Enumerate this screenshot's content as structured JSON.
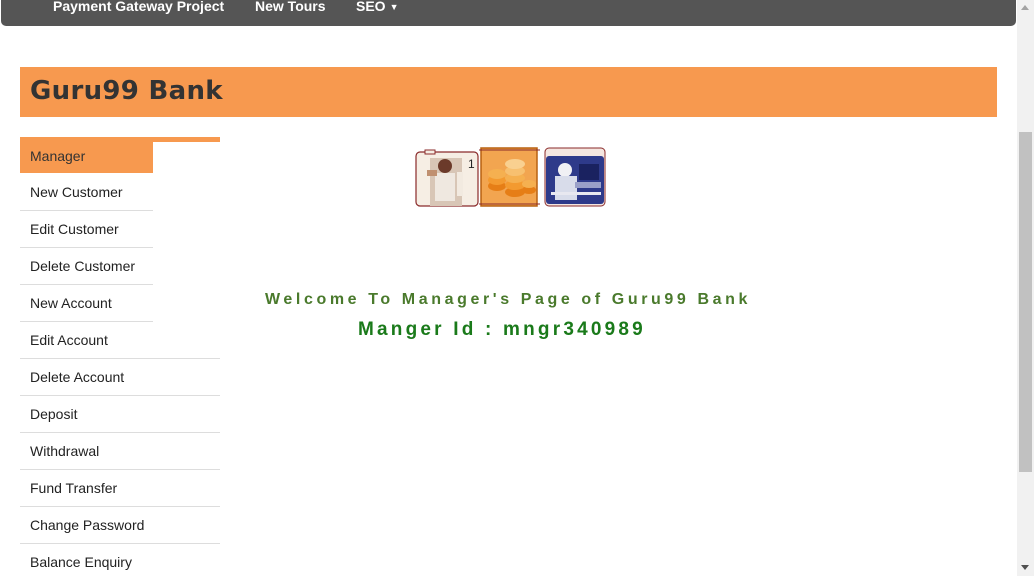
{
  "navbar": {
    "items": [
      {
        "label": "Payment Gateway Project"
      },
      {
        "label": "New Tours"
      },
      {
        "label": "SEO",
        "has_dropdown": true
      }
    ]
  },
  "banner": {
    "title": "Guru99 Bank",
    "color": "#f7994f"
  },
  "sidebar": {
    "items": [
      {
        "label": "Manager",
        "active": true
      },
      {
        "label": "New Customer"
      },
      {
        "label": "Edit Customer"
      },
      {
        "label": "Delete Customer"
      },
      {
        "label": "New Account"
      },
      {
        "label": "Edit Account"
      },
      {
        "label": "Delete Account"
      },
      {
        "label": "Deposit"
      },
      {
        "label": "Withdrawal"
      },
      {
        "label": "Fund Transfer"
      },
      {
        "label": "Change Password"
      },
      {
        "label": "Balance Enquiry"
      }
    ]
  },
  "main": {
    "welcome_text": "Welcome To Manager's Page of Guru99 Bank",
    "manager_id_text": "Manger Id : mngr340989"
  },
  "colors": {
    "navbar_bg": "#555555",
    "accent": "#f7994f",
    "welcome_green": "#4a7a2c",
    "id_green": "#1a7a1a"
  }
}
